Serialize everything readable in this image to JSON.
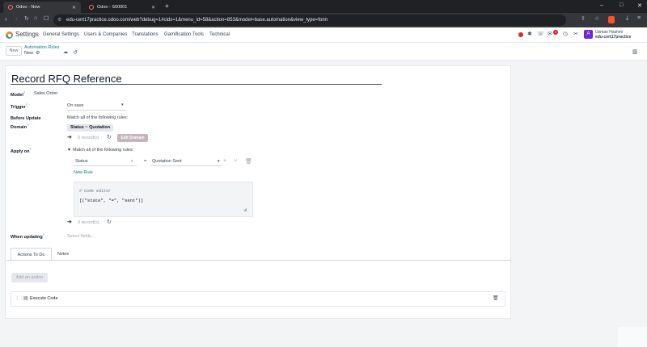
{
  "browser": {
    "tabs": [
      {
        "title": "Odoo - New"
      },
      {
        "title": "Odoo - S00001"
      }
    ],
    "new_tab": "+",
    "url": "edu-cert17practice.odoo.com/web?debug=1#cids=1&menu_id=58&action=853&model=base.automation&view_type=form",
    "window": {
      "min": "–",
      "max": "□",
      "close": "✕"
    }
  },
  "navbar": {
    "app_name": "Settings",
    "menu": [
      "General Settings",
      "Users & Companies",
      "Translations",
      "Gamification Tools",
      "Technical"
    ],
    "chat_badge": "1",
    "avatar_letter": "A",
    "user_name": "Usman Hashmi",
    "db_name": "edu-cert17practice"
  },
  "control": {
    "new_label": "New",
    "breadcrumb": "Automation Rules",
    "current": "New"
  },
  "form": {
    "title": "Record RFQ Reference",
    "model_label": "Model",
    "model_value": "Sales Order",
    "trigger_label": "Trigger",
    "trigger_value": "On save",
    "before_label_1": "Before Update",
    "before_label_2": "Domain",
    "match_text": "Match all of the following rules:",
    "chip_field": "Status",
    "chip_op": "=",
    "chip_value": "Quotation",
    "records_1": "0 record(s)",
    "edit_domain": "Edit Domain",
    "apply_label": "Apply on",
    "apply_match": "Match all of the following rules:",
    "rule_field": "Status",
    "rule_op": "=",
    "rule_value": "Quotation Sent",
    "new_rule": "New Rule",
    "code_comment": "# Code editor",
    "code_value": "[(\"state\", \"=\", \"sent\")]",
    "records_2": "0 record(s)",
    "when_label": "When updating",
    "when_placeholder": "Select fields..."
  },
  "tabs": [
    {
      "label": "Actions To Do"
    },
    {
      "label": "Notes"
    }
  ],
  "actions": {
    "add_label": "Add an action",
    "row_label": "Execute Code"
  }
}
